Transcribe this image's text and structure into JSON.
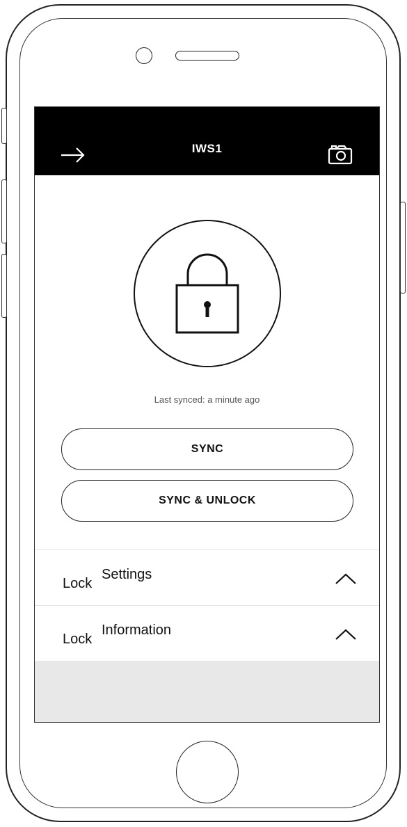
{
  "header": {
    "title": "IWS1",
    "back_icon": "arrow-right-icon",
    "camera_icon": "camera-icon"
  },
  "status": {
    "last_synced": "Last synced: a minute ago",
    "lock_icon": "padlock-icon"
  },
  "actions": {
    "sync_label": "SYNC",
    "sync_unlock_label": "SYNC & UNLOCK"
  },
  "sections": [
    {
      "label_a": "Lock",
      "label_b": "Settings",
      "icon": "chevron-up-icon"
    },
    {
      "label_a": "Lock",
      "label_b": "Information",
      "icon": "chevron-up-icon"
    }
  ],
  "colors": {
    "header_bg": "#000000",
    "footer_bg": "#e8e8e8"
  }
}
